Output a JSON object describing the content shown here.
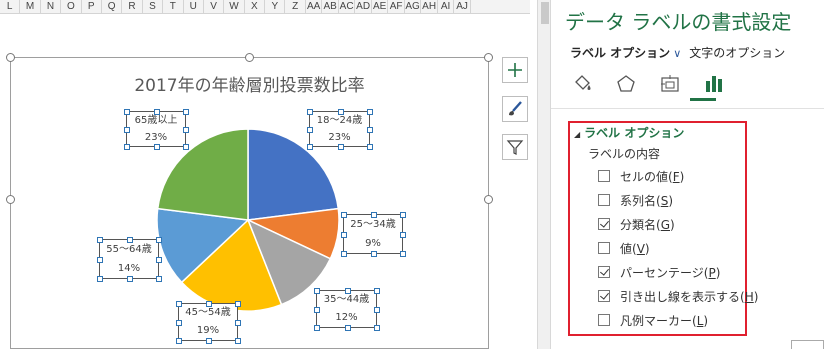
{
  "sheet": {
    "columns": [
      "L",
      "M",
      "N",
      "O",
      "P",
      "Q",
      "R",
      "S",
      "T",
      "U",
      "V",
      "W",
      "X",
      "Y",
      "Z",
      "AA",
      "AB",
      "AC",
      "AD",
      "AE",
      "AF",
      "AG",
      "AH",
      "AI",
      "AJ"
    ]
  },
  "chart_data": {
    "type": "pie",
    "title": "2017年の年齢層別投票数比率",
    "categories": [
      "18～24歳",
      "25～34歳",
      "35～44歳",
      "45～54歳",
      "55～64歳",
      "65歳以上"
    ],
    "values": [
      23,
      9,
      12,
      19,
      14,
      23
    ],
    "percent_labels": [
      "23%",
      "9%",
      "12%",
      "19%",
      "14%",
      "23%"
    ],
    "colors": [
      "#4472c4",
      "#ed7d31",
      "#a5a5a5",
      "#ffc000",
      "#5b9bd5",
      "#70ad47"
    ]
  },
  "panel": {
    "title": "データ ラベルの書式設定",
    "tab_label_options": "ラベル オプション",
    "tab_text_options": "文字のオプション",
    "section_title": "ラベル オプション",
    "label_contents": "ラベルの内容",
    "options": [
      {
        "label": "セルの値",
        "key": "F",
        "checked": false
      },
      {
        "label": "系列名",
        "key": "S",
        "checked": false
      },
      {
        "label": "分類名",
        "key": "G",
        "checked": true
      },
      {
        "label": "値",
        "key": "V",
        "checked": false
      },
      {
        "label": "パーセンテージ",
        "key": "P",
        "checked": true
      },
      {
        "label": "引き出し線を表示する",
        "key": "H",
        "checked": true
      },
      {
        "label": "凡例マーカー",
        "key": "L",
        "checked": false
      }
    ]
  }
}
